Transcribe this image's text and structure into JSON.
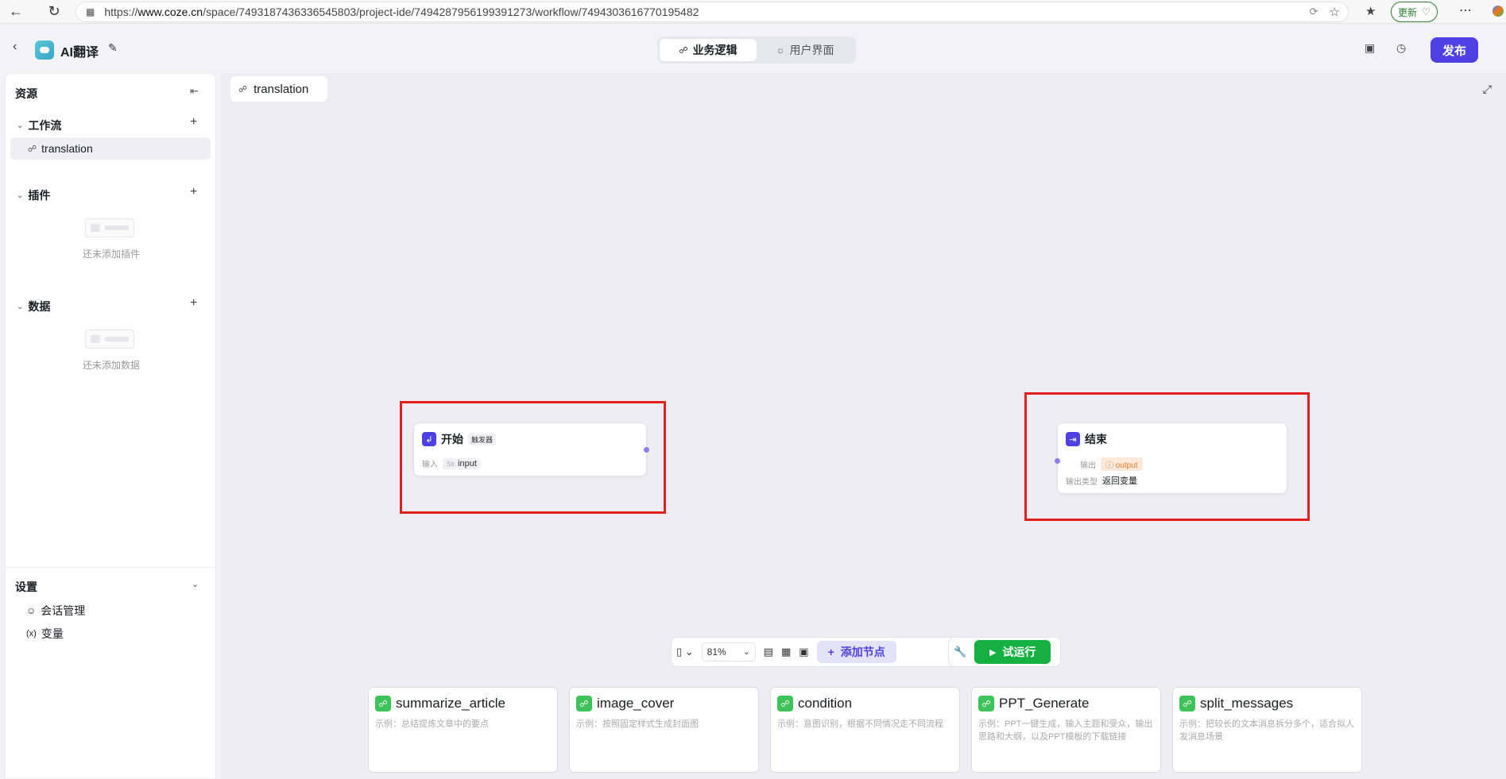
{
  "browser": {
    "url_prefix": "https://",
    "url_host": "www.coze.cn",
    "url_path": "/space/7493187436336545803/project-ide/7494287956199391273/workflow/7494303616770195482",
    "update_label": "更新"
  },
  "header": {
    "app_title": "AI翻译",
    "tabs": [
      {
        "label": "业务逻辑"
      },
      {
        "label": "用户界面"
      }
    ],
    "publish_label": "发布"
  },
  "sidebar": {
    "title": "资源",
    "workflow_section": "工作流",
    "workflow_item": "translation",
    "plugin_section": "插件",
    "plugin_empty": "还未添加插件",
    "data_section": "数据",
    "data_empty": "还未添加数据",
    "settings_title": "设置",
    "settings_items": [
      {
        "label": "会话管理"
      },
      {
        "label": "变量"
      }
    ]
  },
  "canvas": {
    "tab_label": "translation",
    "start_node": {
      "title": "开始",
      "tag": "触发器",
      "input_label": "输入",
      "input_type": "Str.",
      "input_name": "input"
    },
    "end_node": {
      "title": "结束",
      "output_label": "输出",
      "output_name": "output",
      "output_type_label": "输出类型",
      "output_type_value": "返回变量"
    }
  },
  "toolbar": {
    "zoom": "81%",
    "add_node_label": "添加节点",
    "run_label": "试运行"
  },
  "templates": [
    {
      "title": "summarize_article",
      "desc": "示例：总结提炼文章中的要点"
    },
    {
      "title": "image_cover",
      "desc": "示例：按照固定样式生成封面图"
    },
    {
      "title": "condition",
      "desc": "示例：意图识别，根据不同情况走不同流程"
    },
    {
      "title": "PPT_Generate",
      "desc": "示例：PPT一键生成，输入主题和受众，输出思路和大纲，以及PPT模板的下载链接"
    },
    {
      "title": "split_messages",
      "desc": "示例：把较长的文本消息拆分多个，适合拟人发消息场景"
    }
  ],
  "colors": {
    "accent": "#4e40e5",
    "run_green": "#14b041",
    "template_green": "#3ec25a",
    "highlight_red": "#e41e1e"
  }
}
